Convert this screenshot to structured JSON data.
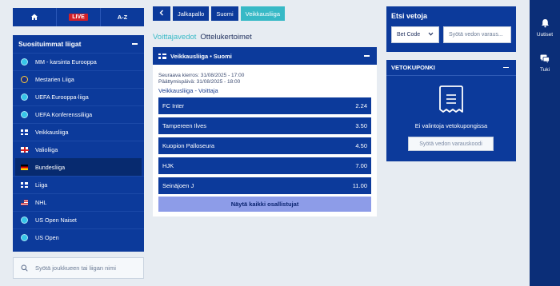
{
  "topnav": {
    "home_icon": "home-icon",
    "live_label": "LIVE",
    "az_label": "A-Z"
  },
  "leagues": {
    "title": "Suosituimmat liigat",
    "items": [
      {
        "label": "MM - karsinta Eurooppa",
        "icon": "globe-icon"
      },
      {
        "label": "Mestarien Liiga",
        "icon": "eu-stars-icon"
      },
      {
        "label": "UEFA Eurooppa-liiga",
        "icon": "globe-icon"
      },
      {
        "label": "UEFA Konferenssiliiga",
        "icon": "globe-icon"
      },
      {
        "label": "Veikkausliiga",
        "icon": "flag-finland-icon"
      },
      {
        "label": "Valioliiga",
        "icon": "flag-england-icon"
      },
      {
        "label": "Bundesliiga",
        "icon": "flag-germany-icon"
      },
      {
        "label": "Liiga",
        "icon": "flag-finland-icon"
      },
      {
        "label": "NHL",
        "icon": "flag-usa-icon"
      },
      {
        "label": "US Open Naiset",
        "icon": "globe-icon"
      },
      {
        "label": "US Open",
        "icon": "globe-icon"
      }
    ],
    "active_index": 6
  },
  "search_left": {
    "placeholder": "Syötä joukkueen tai liigan nimi"
  },
  "breadcrumb": {
    "items": [
      "Jalkapallo",
      "Suomi",
      "Veikkausliiga"
    ]
  },
  "tabs": {
    "first": "Voittajavedot",
    "second": "Ottelukertoimet"
  },
  "market": {
    "header": "Veikkausliiga • Suomi",
    "next_round": "Seuraava kierros: 31/08/2025 - 17:00",
    "end_date": "Päättymispäivä: 31/08/2025 - 18:00",
    "title": "Veikkausliiga - Voittaja",
    "selections": [
      {
        "name": "FC Inter",
        "odds": "2.24"
      },
      {
        "name": "Tampereen Ilves",
        "odds": "3.50"
      },
      {
        "name": "Kuopion Palloseura",
        "odds": "4.50"
      },
      {
        "name": "HJK",
        "odds": "7.00"
      },
      {
        "name": "Seinäjoen J",
        "odds": "11.00"
      }
    ],
    "show_all": "Näytä kaikki osallistujat"
  },
  "bets": {
    "title": "Etsi vetoja",
    "select_value": "Bet Code",
    "input_placeholder": "Syötä vedon varaus..."
  },
  "coupon": {
    "title": "VETOKUPONKI",
    "empty_text": "Ei valintoja vetokupongissa",
    "field_placeholder": "Syötä vedon varauskoodi"
  },
  "rail": {
    "news_label": "Uutiset",
    "support_label": "Tuki"
  },
  "colors": {
    "primary": "#0c3a9b",
    "accent": "#37b9c6",
    "live": "#d3202a",
    "background": "#e7ecf2",
    "show_all": "#8d9ce8"
  }
}
